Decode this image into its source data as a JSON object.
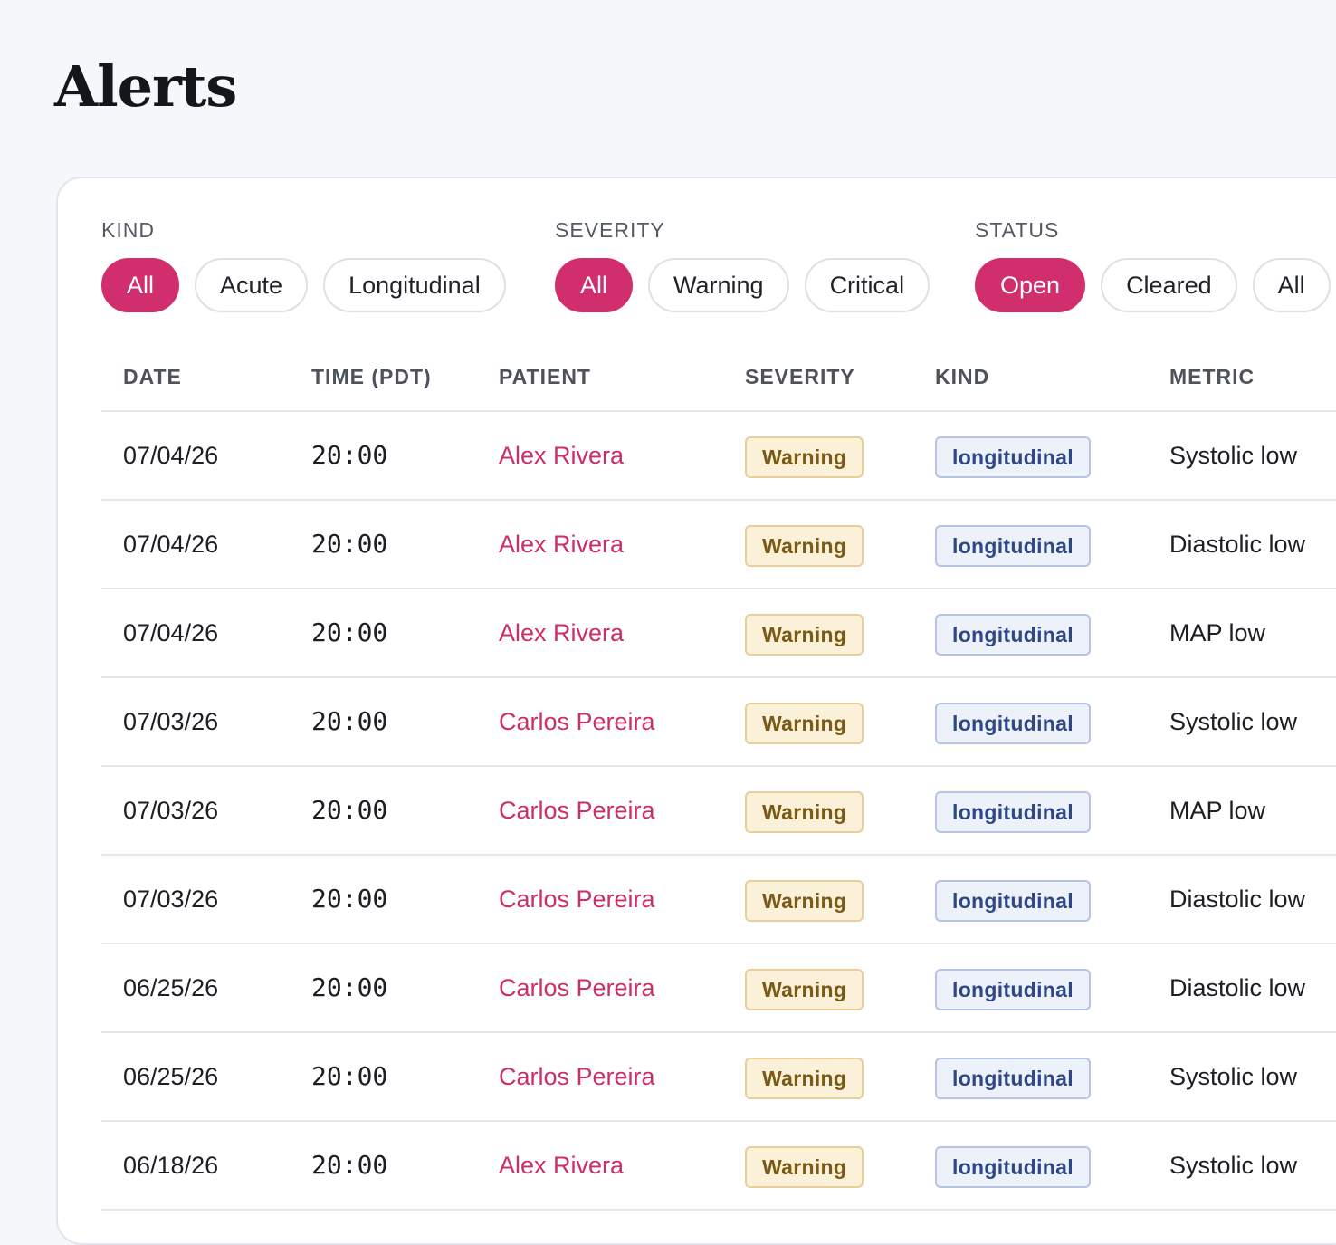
{
  "page": {
    "title": "Alerts"
  },
  "filters": {
    "kind": {
      "label": "KIND",
      "options": [
        "All",
        "Acute",
        "Longitudinal"
      ],
      "selected": "All"
    },
    "severity": {
      "label": "SEVERITY",
      "options": [
        "All",
        "Warning",
        "Critical"
      ],
      "selected": "All"
    },
    "status": {
      "label": "STATUS",
      "options": [
        "Open",
        "Cleared",
        "All"
      ],
      "selected": "Open"
    }
  },
  "table": {
    "headers": {
      "date": "DATE",
      "time": "TIME (PDT)",
      "patient": "PATIENT",
      "severity": "SEVERITY",
      "kind": "KIND",
      "metric": "METRIC"
    },
    "rows": [
      {
        "date": "07/04/26",
        "time": "20:00",
        "patient": "Alex Rivera",
        "severity": "Warning",
        "kind": "longitudinal",
        "metric": "Systolic low"
      },
      {
        "date": "07/04/26",
        "time": "20:00",
        "patient": "Alex Rivera",
        "severity": "Warning",
        "kind": "longitudinal",
        "metric": "Diastolic low"
      },
      {
        "date": "07/04/26",
        "time": "20:00",
        "patient": "Alex Rivera",
        "severity": "Warning",
        "kind": "longitudinal",
        "metric": "MAP low"
      },
      {
        "date": "07/03/26",
        "time": "20:00",
        "patient": "Carlos Pereira",
        "severity": "Warning",
        "kind": "longitudinal",
        "metric": "Systolic low"
      },
      {
        "date": "07/03/26",
        "time": "20:00",
        "patient": "Carlos Pereira",
        "severity": "Warning",
        "kind": "longitudinal",
        "metric": "MAP low"
      },
      {
        "date": "07/03/26",
        "time": "20:00",
        "patient": "Carlos Pereira",
        "severity": "Warning",
        "kind": "longitudinal",
        "metric": "Diastolic low"
      },
      {
        "date": "06/25/26",
        "time": "20:00",
        "patient": "Carlos Pereira",
        "severity": "Warning",
        "kind": "longitudinal",
        "metric": "Diastolic low"
      },
      {
        "date": "06/25/26",
        "time": "20:00",
        "patient": "Carlos Pereira",
        "severity": "Warning",
        "kind": "longitudinal",
        "metric": "Systolic low"
      },
      {
        "date": "06/18/26",
        "time": "20:00",
        "patient": "Alex Rivera",
        "severity": "Warning",
        "kind": "longitudinal",
        "metric": "Systolic low"
      }
    ]
  },
  "colors": {
    "accent": "#d02e6c",
    "warning_bg": "#fbf1d9",
    "warning_text": "#7a5a14",
    "kind_bg": "#edf1fa",
    "kind_text": "#2f4785"
  }
}
